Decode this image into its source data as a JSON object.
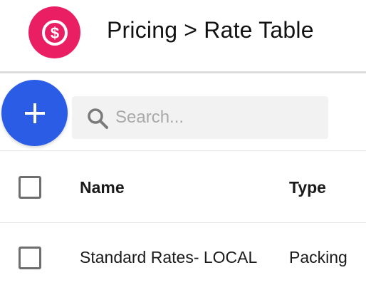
{
  "header": {
    "title": "Pricing > Rate Table",
    "icon": "dollar-circle-icon",
    "icon_color": "#ea1f63"
  },
  "toolbar": {
    "add_button_icon": "plus-icon",
    "add_button_color": "#2a5ce6",
    "search": {
      "placeholder": "Search...",
      "value": ""
    }
  },
  "table": {
    "columns": [
      "Name",
      "Type"
    ],
    "rows": [
      {
        "name": "Standard Rates- LOCAL",
        "type": "Packing",
        "checked": false
      }
    ]
  }
}
